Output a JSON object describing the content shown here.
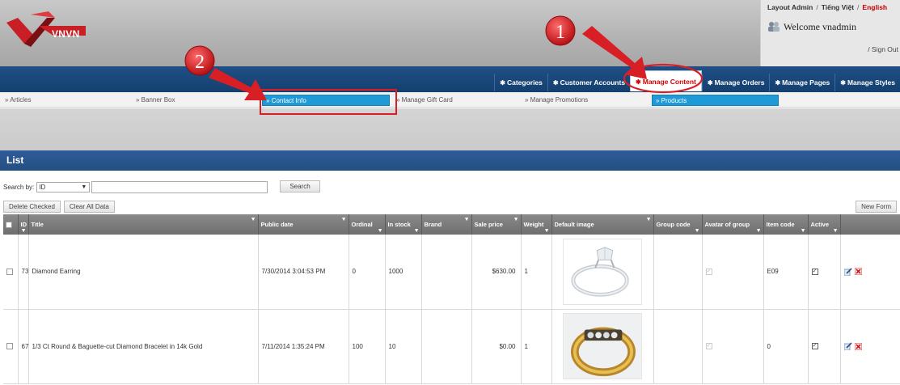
{
  "header": {
    "logo_text": "VNVN",
    "top_links": [
      "Layout Admin",
      "Tiếng Việt",
      "English"
    ],
    "welcome": "Welcome vnadmin",
    "signout": "/ Sign Out"
  },
  "nav": {
    "items": [
      "Categories",
      "Customer Accounts",
      "Manage Content",
      "Manage Orders",
      "Manage Pages",
      "Manage Styles"
    ],
    "active": "Manage Content"
  },
  "submenu": {
    "items": [
      "» Articles",
      "» Banner Box",
      "» Contact Info",
      "» Manage Gift Card",
      "» Manage Promotions",
      "» Products"
    ],
    "active": [
      "» Contact Info",
      "» Products"
    ]
  },
  "list": {
    "title": "List",
    "search_label": "Search by:",
    "search_field": "ID",
    "search_value": "",
    "search_button": "Search",
    "delete_checked": "Delete Checked",
    "clear_all": "Clear All Data",
    "new_form": "New Form"
  },
  "table": {
    "columns": [
      "",
      "ID",
      "Title",
      "Public date",
      "Ordinal",
      "In stock",
      "Brand",
      "Sale price",
      "Weight",
      "Default image",
      "Group code",
      "Avatar of group",
      "Item code",
      "Active",
      ""
    ],
    "rows": [
      {
        "id": "73",
        "title": "Diamond Earring",
        "public_date": "7/30/2014 3:04:53 PM",
        "ordinal": "0",
        "in_stock": "1000",
        "brand": "",
        "sale_price": "$630.00",
        "weight": "1",
        "image": "silver-diamond-ring",
        "group_code": "",
        "item_code": "E09"
      },
      {
        "id": "67",
        "title": "1/3 Ct Round & Baguette-cut Diamond Bracelet in 14k Gold",
        "public_date": "7/11/2014 1:35:24 PM",
        "ordinal": "100",
        "in_stock": "10",
        "brand": "",
        "sale_price": "$0.00",
        "weight": "1",
        "image": "gold-diamond-ring",
        "group_code": "",
        "item_code": "0"
      }
    ]
  },
  "annotations": {
    "step1": "1",
    "step2": "2",
    "color": "#d81f26"
  },
  "colors": {
    "nav_bg": "#1b4a7e",
    "active_tab_text": "#d40000",
    "submenu_active": "#1f9ad6"
  }
}
